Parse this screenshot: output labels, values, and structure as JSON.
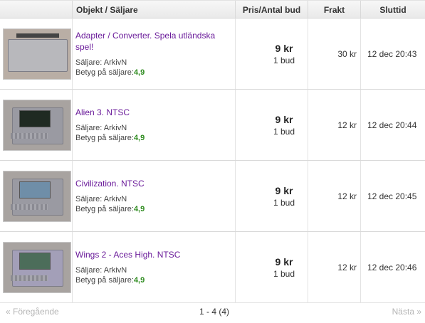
{
  "header": {
    "object_seller": "Objekt / Säljare",
    "price_bids": "Pris/Antal bud",
    "shipping": "Frakt",
    "end_time": "Sluttid"
  },
  "items": [
    {
      "title": "Adapter / Converter. Spela utländska spel!",
      "seller": "Säljare: ArkivN",
      "rating_label": "Betyg på säljare:",
      "rating": "4,9",
      "price": "9 kr",
      "bids": "1 bud",
      "shipping": "30 kr",
      "end": "12 dec 20:43",
      "thumb_icon": "converter-adapter-photo"
    },
    {
      "title": "Alien 3. NTSC",
      "seller": "Säljare: ArkivN",
      "rating_label": "Betyg på säljare:",
      "rating": "4,9",
      "price": "9 kr",
      "bids": "1 bud",
      "shipping": "12 kr",
      "end": "12 dec 20:44",
      "thumb_icon": "snes-cartridge-photo"
    },
    {
      "title": "Civilization. NTSC",
      "seller": "Säljare: ArkivN",
      "rating_label": "Betyg på säljare:",
      "rating": "4,9",
      "price": "9 kr",
      "bids": "1 bud",
      "shipping": "12 kr",
      "end": "12 dec 20:45",
      "thumb_icon": "snes-cartridge-photo"
    },
    {
      "title": "Wings 2 - Aces High. NTSC",
      "seller": "Säljare: ArkivN",
      "rating_label": "Betyg på säljare:",
      "rating": "4,9",
      "price": "9 kr",
      "bids": "1 bud",
      "shipping": "12 kr",
      "end": "12 dec 20:46",
      "thumb_icon": "snes-cartridge-photo"
    }
  ],
  "pager": {
    "prev": "« Föregående",
    "range": "1 - 4 (4)",
    "next": "Nästa »"
  },
  "colors": {
    "title_link": "#6a1b9a",
    "rating": "#2e8b1f",
    "disabled_nav": "#b5b5b5"
  }
}
